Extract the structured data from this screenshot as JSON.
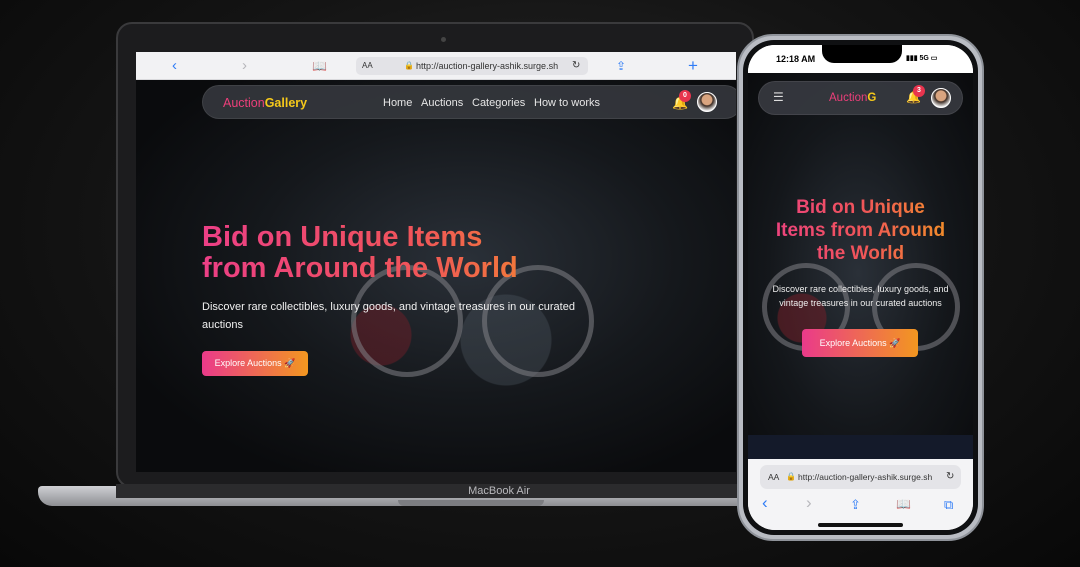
{
  "laptop": {
    "device_label": "MacBook Air",
    "browser": {
      "back_icon": "chevron-left-icon",
      "forward_icon": "chevron-right-icon",
      "reader_label": "AA",
      "url": "http://auction-gallery-ashik.surge.sh"
    },
    "site": {
      "brand_part1": "Auction",
      "brand_part2": "Gallery",
      "nav_links": [
        "Home",
        "Auctions",
        "Categories",
        "How to works"
      ],
      "notification_count": "0",
      "hero_title_line1": "Bid on Unique Items",
      "hero_title_line2": "from Around the World",
      "hero_subtitle": "Discover rare collectibles, luxury goods, and vintage treasures in our curated auctions",
      "cta_label": "Explore Auctions",
      "cta_icon": "rocket-icon"
    }
  },
  "phone": {
    "status": {
      "time": "12:18 AM",
      "network": "5G"
    },
    "site": {
      "brand_part1": "Auction",
      "brand_part2": "G",
      "notification_count": "3",
      "hero_title_line1": "Bid on Unique",
      "hero_title_line2": "Items from Around",
      "hero_title_line3": "the World",
      "hero_subtitle": "Discover rare collectibles, luxury goods, and vintage treasures in our curated auctions",
      "cta_label": "Explore Auctions"
    },
    "browser": {
      "reader_label": "AA",
      "url": "http://auction-gallery-ashik.surge.sh"
    }
  },
  "colors": {
    "brand_pink": "#ec3f7a",
    "brand_yellow": "#f6c91a",
    "gradient_start": "#ec3f86",
    "gradient_end": "#f39a1e",
    "safari_blue": "#2f7cf6"
  }
}
